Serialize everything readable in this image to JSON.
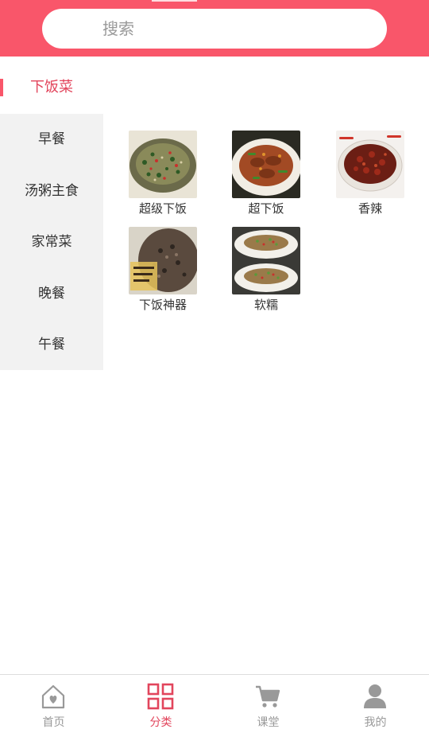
{
  "search": {
    "placeholder": "搜索",
    "value": ""
  },
  "sidebar": {
    "active": "下饭菜",
    "items": [
      {
        "label": "早餐"
      },
      {
        "label": "汤粥主食"
      },
      {
        "label": "家常菜"
      },
      {
        "label": "晚餐"
      },
      {
        "label": "午餐"
      }
    ]
  },
  "grid": {
    "items": [
      {
        "caption": "超级下饭",
        "image": "stir-fried-greens-with-minced-meat"
      },
      {
        "caption": "超下饭",
        "image": "braised-meat-with-peppers"
      },
      {
        "caption": "香辣",
        "image": "spicy-dry-fried-chili"
      },
      {
        "caption": "下饭神器",
        "image": "chopped-pickled-vegetables"
      },
      {
        "caption": "软糯",
        "image": "rice-with-minced-topping"
      }
    ]
  },
  "tabbar": {
    "items": [
      {
        "label": "首页",
        "icon": "home-icon",
        "active": false
      },
      {
        "label": "分类",
        "icon": "grid-icon",
        "active": true
      },
      {
        "label": "课堂",
        "icon": "cart-icon",
        "active": false
      },
      {
        "label": "我的",
        "icon": "user-icon",
        "active": false
      }
    ]
  },
  "colors": {
    "accent": "#f9566a",
    "accent_text": "#e2455c",
    "inactive": "#999999",
    "sidebar_bg": "#f2f2f2"
  }
}
